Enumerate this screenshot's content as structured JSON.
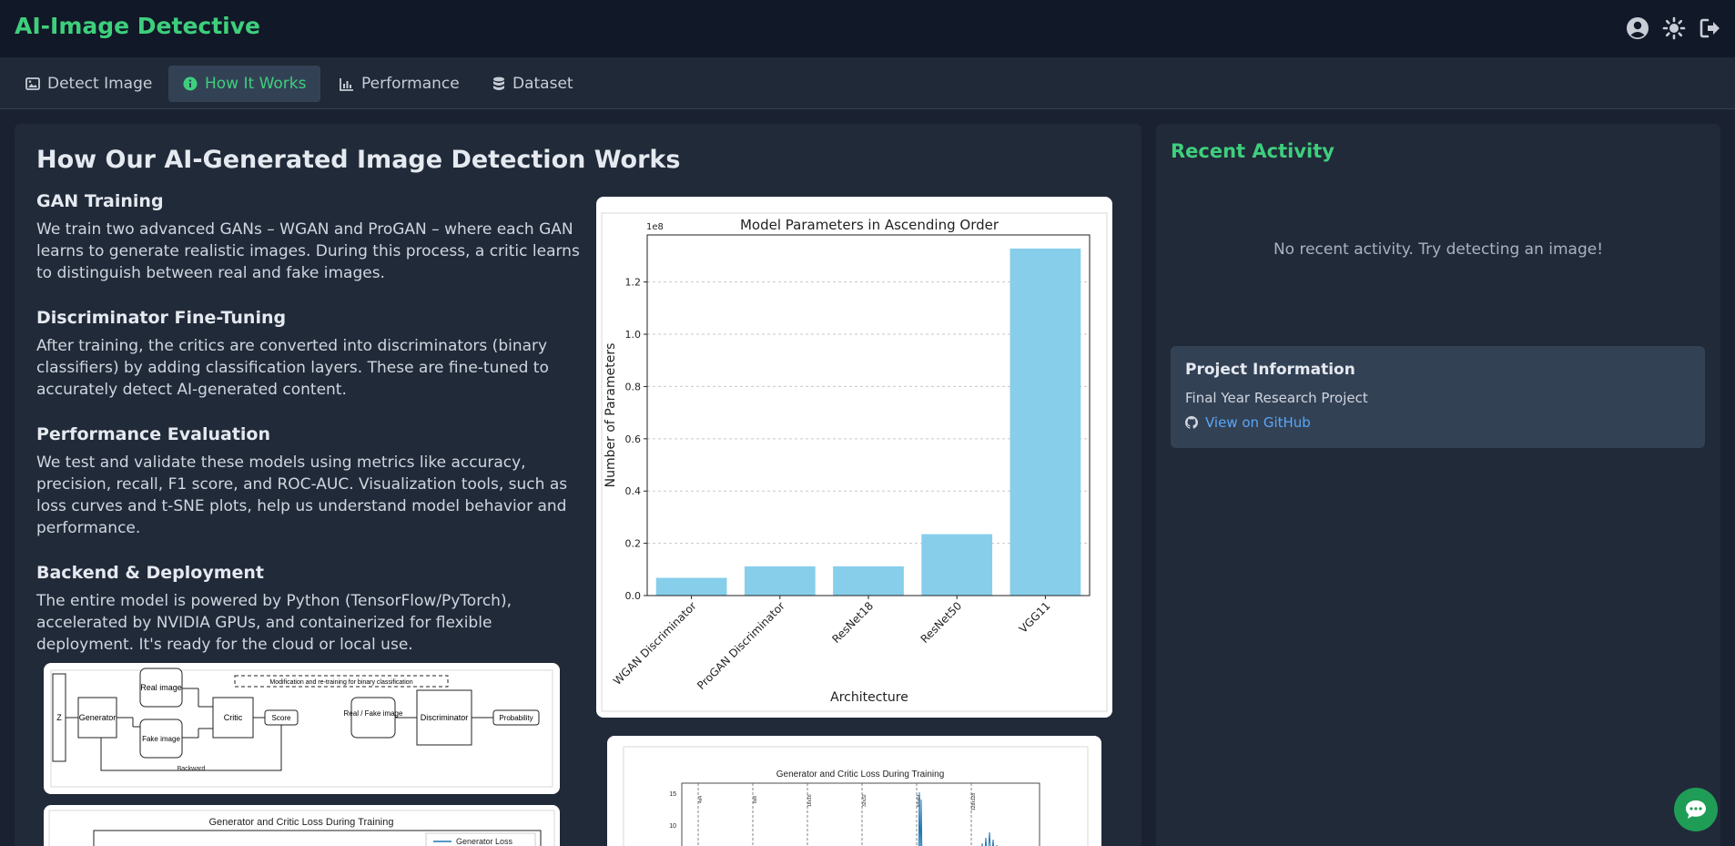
{
  "app": {
    "title": "AI-Image Detective"
  },
  "tabs": [
    {
      "label": "Detect Image",
      "icon": "image-icon"
    },
    {
      "label": "How It Works",
      "icon": "info-icon"
    },
    {
      "label": "Performance",
      "icon": "bar-chart-icon"
    },
    {
      "label": "Dataset",
      "icon": "database-icon"
    }
  ],
  "active_tab": "How It Works",
  "header_icons": [
    "user-circle-icon",
    "sun-icon",
    "logout-icon"
  ],
  "main": {
    "title": "How Our AI-Generated Image Detection Works",
    "sections": [
      {
        "heading": "GAN Training",
        "body": "We train two advanced GANs – WGAN and ProGAN – where each GAN learns to generate realistic images. During this process, a critic learns to distinguish between real and fake images."
      },
      {
        "heading": "Discriminator Fine-Tuning",
        "body": "After training, the critics are converted into discriminators (binary classifiers) by adding classification layers. These are fine-tuned to accurately detect AI-generated content."
      },
      {
        "heading": "Performance Evaluation",
        "body": "We test and validate these models using metrics like accuracy, precision, recall, F1 score, and ROC-AUC. Visualization tools, such as loss curves and t-SNE plots, help us understand model behavior and performance."
      },
      {
        "heading": "Backend & Deployment",
        "body": "The entire model is powered by Python (TensorFlow/PyTorch), accelerated by NVIDIA GPUs, and containerized for flexible deployment. It's ready for the cloud or local use."
      }
    ],
    "diagram": {
      "z": "Z",
      "generator": "Generator",
      "real_image": "Real image",
      "fake_image": "Fake image",
      "critic": "Critic",
      "score": "Score",
      "modification": "Modification and re-training for binary classification",
      "real_fake": "Real / Fake image",
      "discriminator": "Discriminator",
      "probability": "Probability",
      "backward": "Backward"
    },
    "loss_chart_small": {
      "title": "Generator and Critic Loss During Training",
      "legend": "Generator Loss"
    },
    "loss_chart_right": {
      "title": "Generator and Critic Loss During Training",
      "yticks": [
        "15",
        "10"
      ],
      "vlabels": [
        "4x4",
        "8x8",
        "16x16",
        "32x32",
        "64x64",
        "128x128"
      ]
    }
  },
  "chart_data": {
    "type": "bar",
    "title": "Model Parameters in Ascending Order",
    "xlabel": "Architecture",
    "ylabel": "Number of Parameters",
    "multiplier_label": "1e8",
    "categories": [
      "WGAN Discriminator",
      "ProGAN Discriminator",
      "ResNet18",
      "ResNet50",
      "VGG11"
    ],
    "values": [
      6800000,
      11200000,
      11200000,
      23500000,
      132800000
    ],
    "ylim": [
      0,
      138000000
    ],
    "yticks": [
      0,
      20000000,
      40000000,
      60000000,
      80000000,
      100000000,
      120000000
    ],
    "ytick_labels": [
      "0.0",
      "0.2",
      "0.4",
      "0.6",
      "0.8",
      "1.0",
      "1.2"
    ],
    "grid": true,
    "bar_color": "#87ceeb"
  },
  "sidebar": {
    "title": "Recent Activity",
    "empty_message": "No recent activity. Try detecting an image!",
    "project": {
      "title": "Project Information",
      "subtitle": "Final Year Research Project",
      "link": "View on GitHub",
      "link_icon": "github-icon"
    }
  },
  "chat_button": {
    "icon": "chat-icon"
  },
  "colors": {
    "accent": "#3ecf7d",
    "background": "#1a2232",
    "panel": "#212a39",
    "link": "#5aa6f5"
  }
}
